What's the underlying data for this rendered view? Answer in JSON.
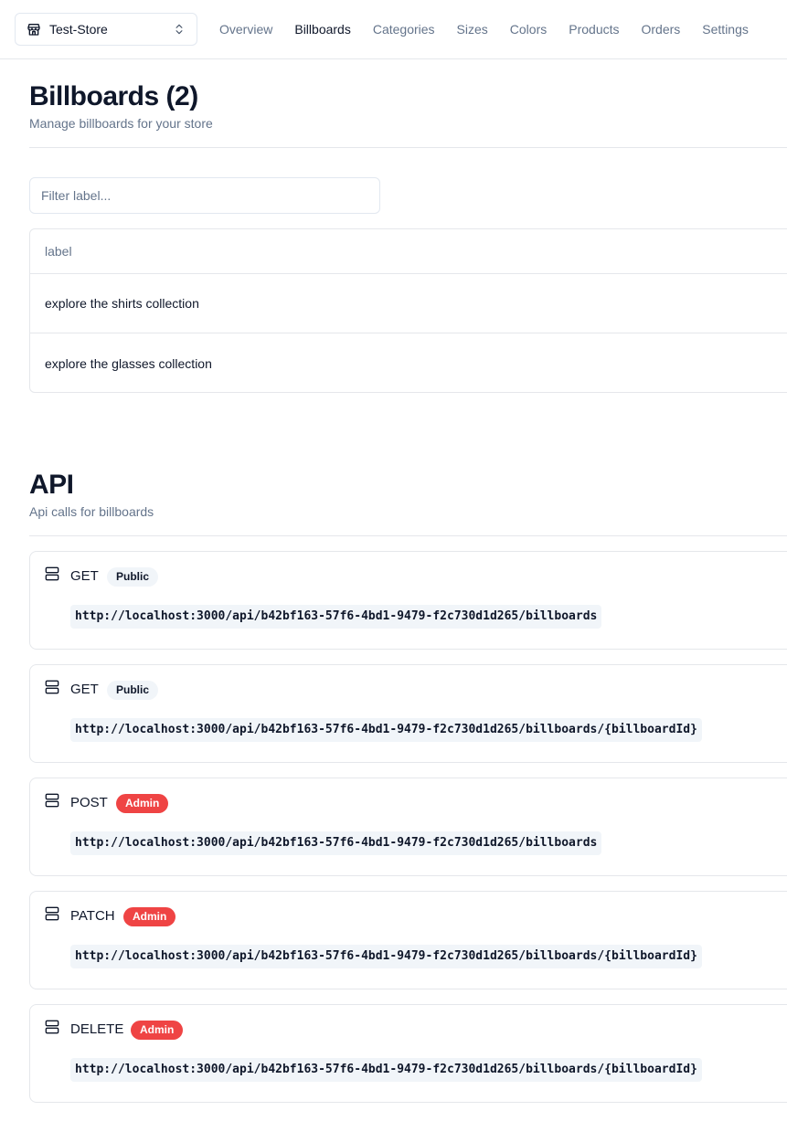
{
  "store_switcher": {
    "name": "Test-Store",
    "icon": "store-icon",
    "chevron": "chevrons-up-down-icon"
  },
  "nav": {
    "items": [
      {
        "label": "Overview",
        "active": false
      },
      {
        "label": "Billboards",
        "active": true
      },
      {
        "label": "Categories",
        "active": false
      },
      {
        "label": "Sizes",
        "active": false
      },
      {
        "label": "Colors",
        "active": false
      },
      {
        "label": "Products",
        "active": false
      },
      {
        "label": "Orders",
        "active": false
      },
      {
        "label": "Settings",
        "active": false
      }
    ]
  },
  "billboards": {
    "title": "Billboards (2)",
    "description": "Manage billboards for your store",
    "filter_placeholder": "Filter label...",
    "table": {
      "columns": [
        "label"
      ],
      "rows": [
        {
          "label": "explore the shirts collection"
        },
        {
          "label": "explore the glasses collection"
        }
      ]
    }
  },
  "api": {
    "title": "API",
    "description": "Api calls for billboards",
    "routes": [
      {
        "method": "GET",
        "access": "Public",
        "url": "http://localhost:3000/api/b42bf163-57f6-4bd1-9479-f2c730d1d265/billboards"
      },
      {
        "method": "GET",
        "access": "Public",
        "url": "http://localhost:3000/api/b42bf163-57f6-4bd1-9479-f2c730d1d265/billboards/{billboardId}"
      },
      {
        "method": "POST",
        "access": "Admin",
        "url": "http://localhost:3000/api/b42bf163-57f6-4bd1-9479-f2c730d1d265/billboards"
      },
      {
        "method": "PATCH",
        "access": "Admin",
        "url": "http://localhost:3000/api/b42bf163-57f6-4bd1-9479-f2c730d1d265/billboards/{billboardId}"
      },
      {
        "method": "DELETE",
        "access": "Admin",
        "url": "http://localhost:3000/api/b42bf163-57f6-4bd1-9479-f2c730d1d265/billboards/{billboardId}"
      }
    ]
  },
  "colors": {
    "admin_badge": "#ef4444",
    "public_badge": "#f1f5f9",
    "muted_text": "#64748b",
    "border": "#e5e7eb"
  }
}
